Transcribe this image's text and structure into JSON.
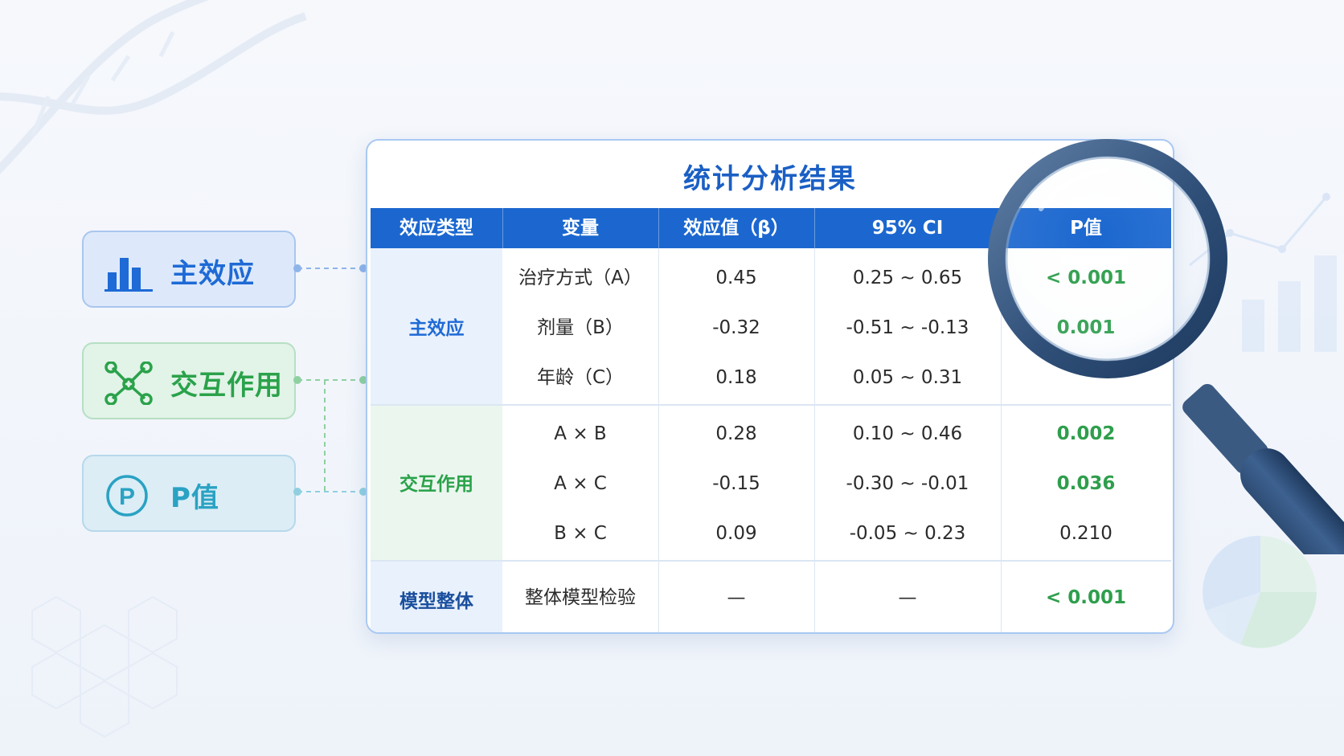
{
  "colors": {
    "main_effect": "#1e6ad6",
    "interaction": "#2aa24a",
    "p_value": "#2aa2c3",
    "header_bg": "#1b67cf",
    "significant_p": "#2e9e4c"
  },
  "legend": [
    {
      "label": "主效应",
      "icon": "bar-chart-icon"
    },
    {
      "label": "交互作用",
      "icon": "network-nodes-icon"
    },
    {
      "label": "P值",
      "icon": "p-circle-icon"
    }
  ],
  "table": {
    "title": "统计分析结果",
    "headers": [
      "效应类型",
      "变量",
      "效应值（β）",
      "95% CI",
      "P值"
    ],
    "groups": [
      {
        "label": "主效应",
        "rows": [
          {
            "variable": "治疗方式（A）",
            "beta": "0.45",
            "ci": "0.25 ~ 0.65",
            "p": "< 0.001"
          },
          {
            "variable": "剂量（B）",
            "beta": "-0.32",
            "ci": "-0.51 ~ -0.13",
            "p": "0.001"
          },
          {
            "variable": "年龄（C）",
            "beta": "0.18",
            "ci": "0.05 ~ 0.31",
            "p": ""
          }
        ]
      },
      {
        "label": "交互作用",
        "rows": [
          {
            "variable": "A × B",
            "beta": "0.28",
            "ci": "0.10 ~ 0.46",
            "p": "0.002"
          },
          {
            "variable": "A × C",
            "beta": "-0.15",
            "ci": "-0.30 ~ -0.01",
            "p": "0.036"
          },
          {
            "variable": "B × C",
            "beta": "0.09",
            "ci": "-0.05 ~ 0.23",
            "p": "0.210"
          }
        ]
      },
      {
        "label": "模型整体",
        "rows": [
          {
            "variable": "整体模型检验",
            "beta": "—",
            "ci": "—",
            "p": "< 0.001"
          }
        ]
      }
    ]
  }
}
